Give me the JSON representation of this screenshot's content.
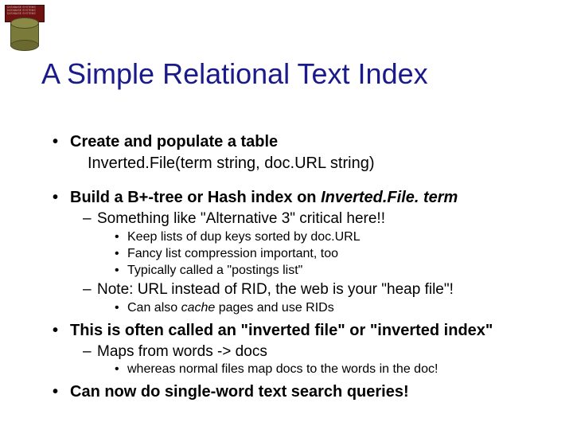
{
  "logo": {
    "line1": "DATABASE SYSTEMS",
    "line2": "DATABASE SYSTEMS",
    "line3": "DATABASE SYSTEMS"
  },
  "title": "A Simple Relational Text Index",
  "b1": {
    "heading": "Create and populate a table",
    "line": "Inverted.File(term string, doc.URL string)"
  },
  "b2": {
    "heading_pre": "Build a B+-tree or Hash index on ",
    "heading_em": "Inverted.File. term",
    "s1": "Something like \"Alternative 3\" critical here!!",
    "s1a": "Keep lists of dup keys sorted by doc.URL",
    "s1b": "Fancy list compression important, too",
    "s1c": "Typically called a \"postings list\"",
    "s2": "Note: URL instead of RID, the web is your \"heap file\"!",
    "s2a_pre": "Can also ",
    "s2a_em": "cache",
    "s2a_post": " pages and use RIDs"
  },
  "b3": {
    "heading": "This is often called an \"inverted file\" or \"inverted index\"",
    "s1": "Maps from words -> docs",
    "s1a": "whereas normal files map docs to the words in the doc!"
  },
  "b4": {
    "heading": "Can now do single-word text search queries!"
  }
}
